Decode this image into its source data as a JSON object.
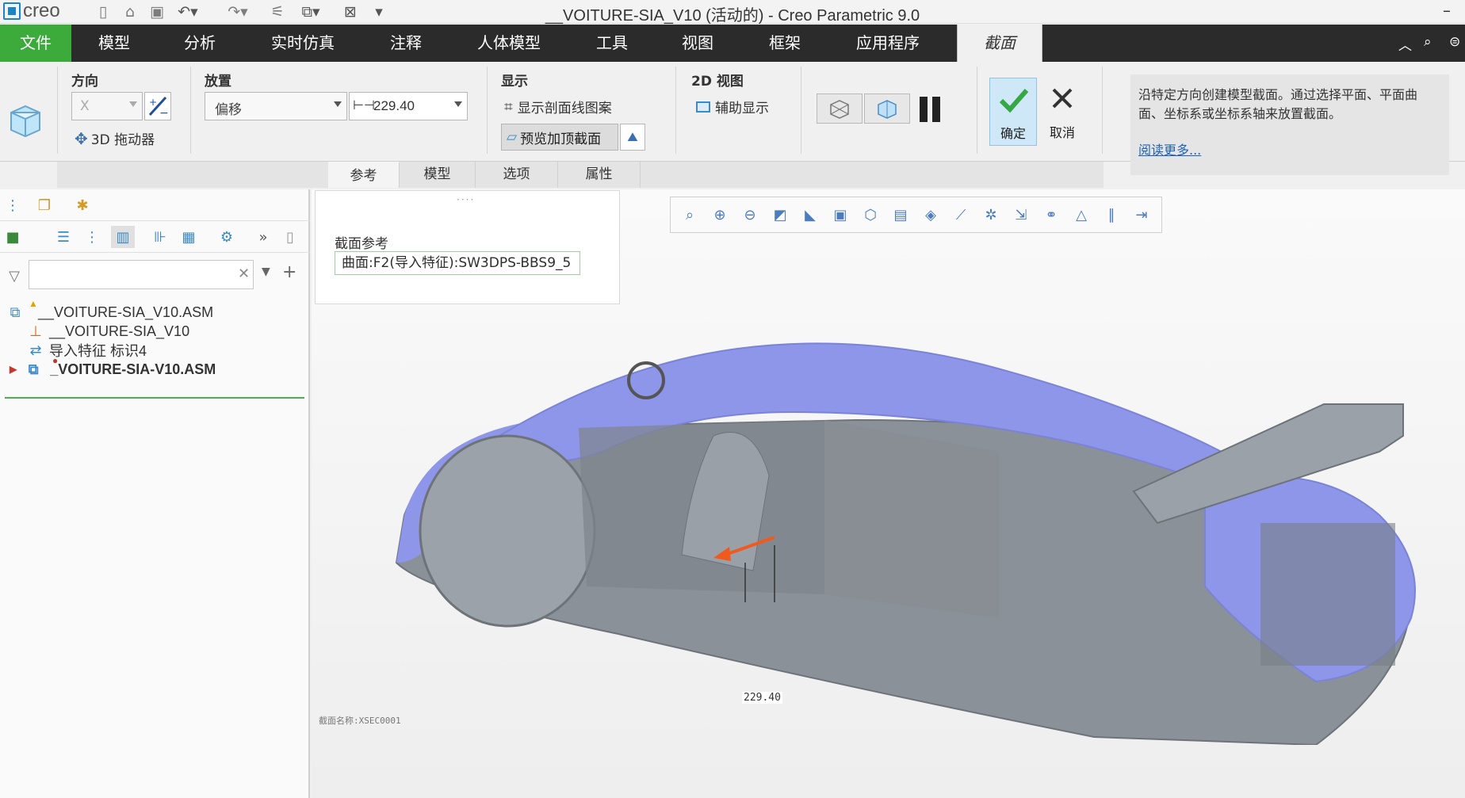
{
  "app": {
    "brand": "creo",
    "window_title": "__VOITURE-SIA_V10 (活动的) - Creo Parametric 9.0",
    "minimize": "–"
  },
  "menu": {
    "items": [
      "文件",
      "模型",
      "分析",
      "实时仿真",
      "注释",
      "人体模型",
      "工具",
      "视图",
      "框架",
      "应用程序",
      "截面"
    ],
    "active": "截面"
  },
  "ribbon": {
    "direction": {
      "label": "方向",
      "axis_value": "X",
      "drag_label": "3D 拖动器"
    },
    "placement": {
      "label": "放置",
      "type_value": "偏移",
      "offset_value": "229.40"
    },
    "display": {
      "label": "显示",
      "hatch_label": "显示剖面线图案",
      "preview_label": "预览加顶截面"
    },
    "view2d": {
      "label": "2D 视图",
      "aux_label": "辅助显示"
    },
    "ok_label": "确定",
    "cancel_label": "取消",
    "info_text": "沿特定方向创建模型截面。通过选择平面、平面曲面、坐标系或坐标系轴来放置截面。",
    "info_link": "阅读更多..."
  },
  "subtabs": [
    "参考",
    "模型",
    "选项",
    "属性"
  ],
  "ref_panel": {
    "label": "截面参考",
    "value": "曲面:F2(导入特征):SW3DPS-BBS9_5"
  },
  "tree": {
    "filter_placeholder": "",
    "items": [
      {
        "label": "__VOITURE-SIA_V10.ASM",
        "icon": "assembly-icon"
      },
      {
        "label": "__VOITURE-SIA_V10",
        "icon": "coordinate-system-icon"
      },
      {
        "label": "导入特征 标识4",
        "icon": "import-feature-icon"
      },
      {
        "label": "_VOITURE-SIA-V10.ASM",
        "icon": "assembly-icon"
      }
    ]
  },
  "viewport": {
    "section_name": "截面名称:XSEC0001",
    "dimension": "229.40"
  },
  "colors": {
    "file_menu": "#3cab3c",
    "menubar": "#2b2b2b",
    "car_body": "#8d96e8",
    "car_interior": "#8b9198",
    "arrow": "#f05a1e"
  }
}
